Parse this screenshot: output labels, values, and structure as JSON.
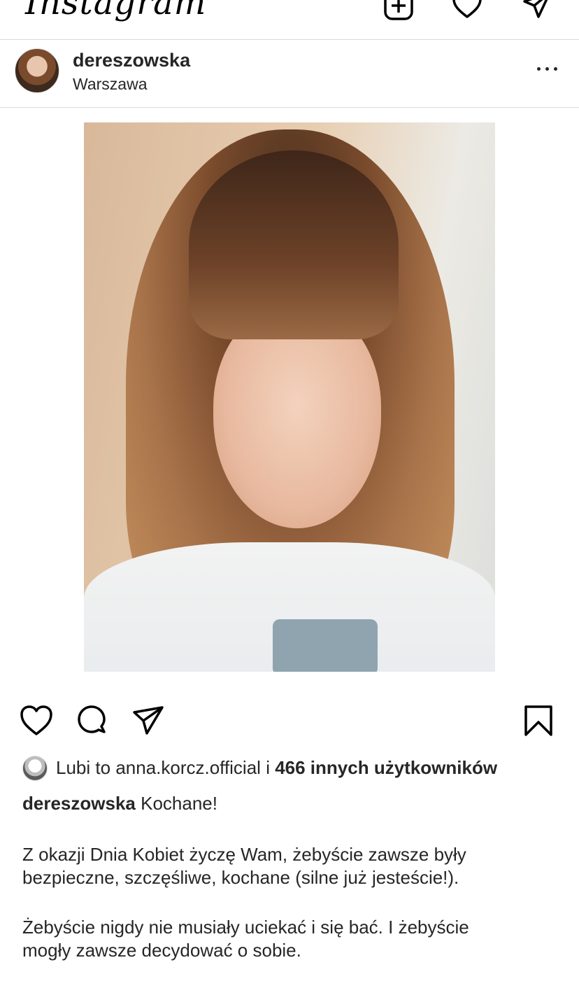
{
  "app": {
    "logo_text": "Instagram"
  },
  "topbar": {
    "icons": [
      "new-post-icon",
      "heart-icon",
      "direct-message-icon"
    ]
  },
  "post": {
    "username": "dereszowska",
    "location": "Warszawa",
    "more_icon": "more-options-icon",
    "image_alt": "selfie"
  },
  "actions": {
    "icons": [
      "like-icon",
      "comment-icon",
      "share-icon",
      "save-icon"
    ]
  },
  "likes": {
    "prefix": "Lubi to",
    "liker": "anna.korcz.official",
    "conjunction": "i",
    "others": "466 innych użytkowników"
  },
  "caption": {
    "username": "dereszowska",
    "first_line": "Kochane!",
    "para1_line1": "Z okazji Dnia Kobiet życzę Wam, żebyście zawsze były",
    "para1_line2": "bezpieczne, szczęśliwe, kochane (silne już jesteście!).",
    "para2_line1": "Żebyście nigdy nie musiały uciekać i się bać. I żebyście",
    "para2_line2": "mogły zawsze decydować o sobie."
  },
  "colors": {
    "text": "#262626",
    "divider": "#dbdbdb",
    "background": "#ffffff"
  }
}
